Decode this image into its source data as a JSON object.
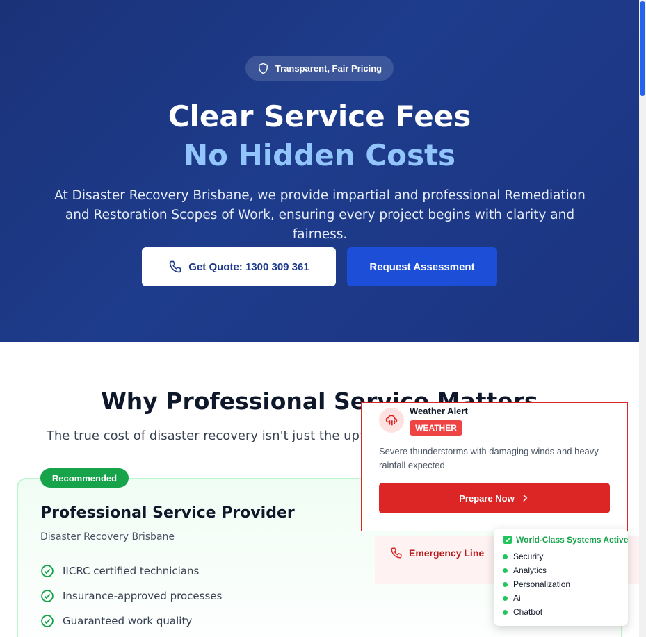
{
  "hero": {
    "badge_label": "Transparent, Fair Pricing",
    "title_line1": "Clear Service Fees",
    "title_line2": "No Hidden Costs",
    "lead": "At Disaster Recovery Brisbane, we provide impartial and professional Remediation and Restoration Scopes of Work, ensuring every project begins with clarity and fairness.",
    "quote_button": "Get Quote: 1300 309 361",
    "assessment_button": "Request Assessment"
  },
  "why": {
    "heading": "Why Professional Service Matters",
    "subheading": "The true cost of disaster recovery isn't just the upfront fee—it's the long-term outcome"
  },
  "card": {
    "badge": "Recommended",
    "title": "Professional Service Provider",
    "subtitle": "Disaster Recovery Brisbane",
    "features": [
      "IICRC certified technicians",
      "Insurance-approved processes",
      "Guaranteed work quality"
    ]
  },
  "emergency": {
    "label": "Emergency Line"
  },
  "alert": {
    "title": "Weather Alert",
    "tag": "WEATHER",
    "message": "Severe thunderstorms with damaging winds and heavy rainfall expected",
    "button": "Prepare Now"
  },
  "systems": {
    "heading": "World-Class Systems Active",
    "items": [
      "Security",
      "Analytics",
      "Personalization",
      "Ai",
      "Chatbot"
    ]
  },
  "colors": {
    "hero_bg": "#1e3a8a",
    "accent_blue": "#1d4ed8",
    "highlight": "#93c5fd",
    "success": "#16a34a",
    "danger": "#dc2626"
  }
}
